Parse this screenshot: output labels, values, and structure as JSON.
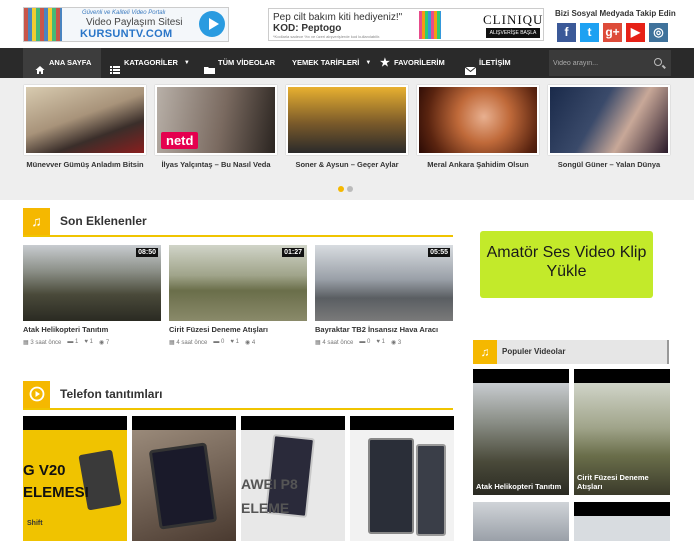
{
  "header": {
    "logo": {
      "tagline": "Güvenli ve Kaliteli Video Portalı",
      "line1": "Video Paylaşım Sitesi",
      "line2": "KURSUNTV.COM"
    },
    "ad": {
      "line1": "Pep cilt bakım kiti hediyeniz!\"",
      "line2": "KOD: Peptogo",
      "fine": "*Kodlarla sadece %x ve üzeri alışverişlerde kod kullanılabilir.",
      "brand": "CLINIQUE",
      "cta": "ALIŞVERİŞE BAŞLA"
    },
    "social_title": "Bizi Sosyal Medyada Takip Edin",
    "social": [
      {
        "glyph": "f",
        "icon": "facebook-icon",
        "color": "#3b5998"
      },
      {
        "glyph": "t",
        "icon": "twitter-icon",
        "color": "#1da1f2"
      },
      {
        "glyph": "g+",
        "icon": "google-plus-icon",
        "color": "#dd4b39"
      },
      {
        "glyph": "▶",
        "icon": "youtube-icon",
        "color": "#e62117"
      },
      {
        "glyph": "◎",
        "icon": "instagram-icon",
        "color": "#3f729b"
      }
    ]
  },
  "nav": {
    "home": "ANA SAYFA",
    "categories": "KATAGORİLER",
    "all_videos": "TÜM VİDEOLAR",
    "recipes": "YEMEK TARİFLERİ",
    "favorites": "FAVORİLERİM",
    "contact": "İLETİŞİM",
    "search_placeholder": "Video arayın..."
  },
  "carousel": {
    "slides": [
      {
        "caption": "Münevver Gümüş Anladım Bitsin"
      },
      {
        "caption": "İlyas Yalçıntaş – Bu Nasıl Veda",
        "badge": "netd"
      },
      {
        "caption": "Soner & Aysun – Geçer Aylar"
      },
      {
        "caption": "Meral Ankara Şahidim Olsun"
      },
      {
        "caption": "Songül Güner – Yalan Dünya"
      }
    ],
    "active_dot": 1
  },
  "recent": {
    "heading": "Son Eklenenler",
    "videos": [
      {
        "title": "Atak Helikopteri Tanıtım",
        "duration": "08:50",
        "age": "3 saat önce",
        "comments": "1",
        "likes": "1",
        "views": "7"
      },
      {
        "title": "Cirit Füzesi Deneme Atışları",
        "duration": "01:27",
        "age": "4 saat önce",
        "comments": "0",
        "likes": "1",
        "views": "4"
      },
      {
        "title": "Bayraktar TB2 İnsansız Hava Aracı",
        "duration": "05:55",
        "age": "4 saat önce",
        "comments": "0",
        "likes": "1",
        "views": "3"
      }
    ]
  },
  "phones": {
    "heading": "Telefon tanıtımları",
    "thumbs": [
      {
        "text1": "G V20",
        "text2": "ELEMESI",
        "sub": "Shift"
      },
      {
        "text1": "",
        "text2": ""
      },
      {
        "text1": "AWEI P8",
        "text2": "ELEME"
      },
      {
        "text1": "",
        "text2": ""
      }
    ]
  },
  "sidebar": {
    "upload_label": "Amatör Ses Video Klip Yükle",
    "popular_heading": "Populer Videolar",
    "popular": [
      {
        "caption": "Atak Helikopteri Tanıtım"
      },
      {
        "caption": "Cirit Füzesi Deneme Atışları"
      }
    ]
  }
}
